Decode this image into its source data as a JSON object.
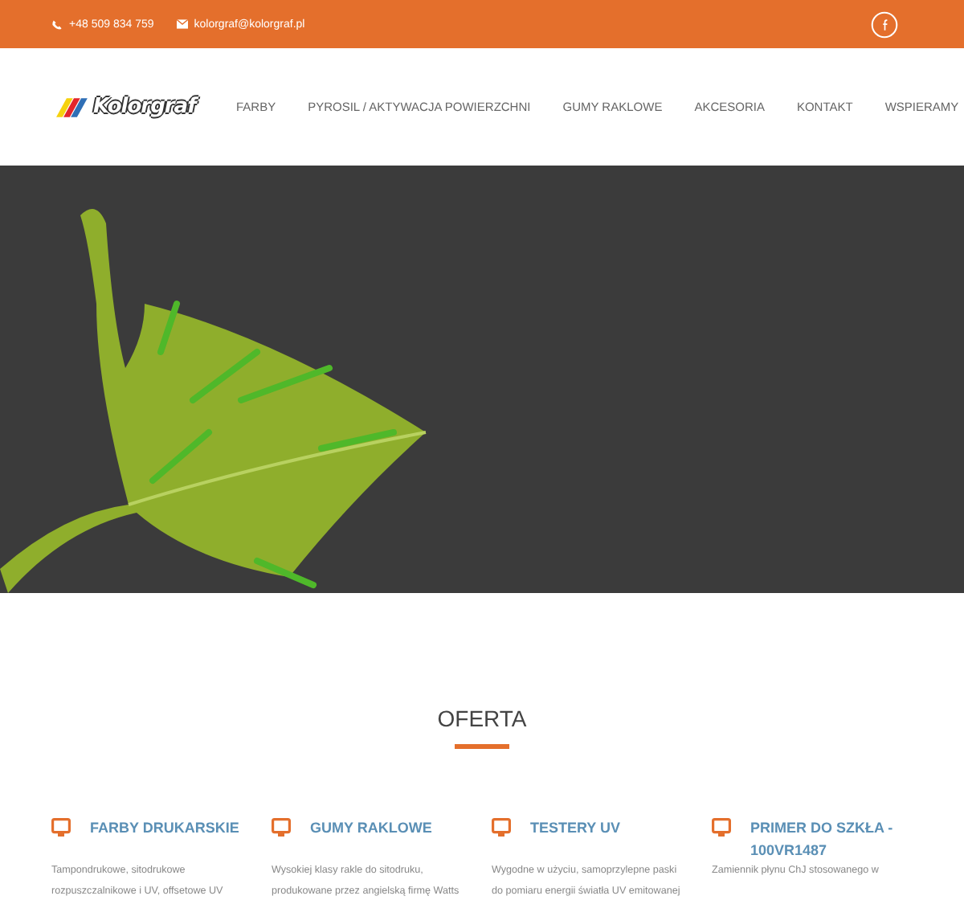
{
  "top_bar": {
    "phone": "+48 509 834 759",
    "email": "kolorgraf@kolorgraf.pl"
  },
  "header": {
    "logo": "Kolorgraf",
    "nav": [
      {
        "label": "FARBY"
      },
      {
        "label": "PYROSIL / AKTYWACJA POWIERZCHNI"
      },
      {
        "label": "GUMY RAKLOWE"
      },
      {
        "label": "AKCESORIA"
      },
      {
        "label": "KONTAKT"
      },
      {
        "label": "WSPIERAMY"
      }
    ]
  },
  "offer": {
    "title": "OFERTA",
    "cards": [
      {
        "title": "FARBY DRUKARSKIE",
        "text": "Tampondrukowe, sitodrukowe rozpuszczalnikowe i UV, offsetowe UV"
      },
      {
        "title": "GUMY RAKLOWE",
        "text": "Wysokiej klasy rakle do sitodruku, produkowane przez angielską firmę Watts"
      },
      {
        "title": "TESTERY UV",
        "text": "Wygodne w użyciu, samoprzylepne paski do pomiaru energii światła UV emitowanej"
      },
      {
        "title": "PRIMER DO SZKŁA - 100VR1487",
        "text": "Zamiennik płynu ChJ stosowanego w"
      }
    ]
  }
}
